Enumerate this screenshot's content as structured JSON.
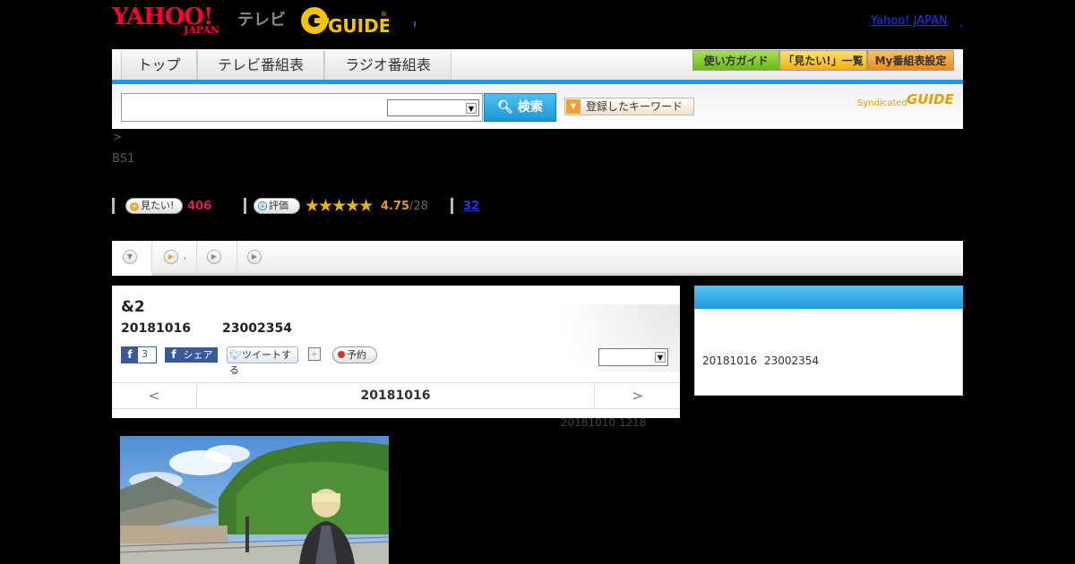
{
  "header": {
    "logo_yahoo": "YAHOO!",
    "logo_japan": "JAPAN",
    "logo_tv": "テレビ",
    "logo_gguide": "GUIDE",
    "yahoo_japan_link": "Yahoo! JAPAN",
    "link_dot": ","
  },
  "nav": {
    "tabs": [
      {
        "label": "トップ"
      },
      {
        "label": "テレビ番組表"
      },
      {
        "label": "ラジオ番組表"
      }
    ],
    "tools": [
      {
        "label": "使い方ガイド",
        "color": "#7ec820"
      },
      {
        "label": "「見たい!」一覧",
        "color": "#f5b800"
      },
      {
        "label": "My番組表設定",
        "color": "#f08c1e"
      }
    ]
  },
  "search": {
    "input_value": "",
    "select_value": "",
    "button_label": "検索",
    "keyword_button": "登録したキーワード",
    "syndicated": "Syndicated",
    "syndicated_g": "GUIDE"
  },
  "breadcrumb": ">",
  "channel": "BS1",
  "stats": {
    "want_label": "見たい!",
    "want_count": "406",
    "rate_label": "評価",
    "stars": "★★★★★",
    "rating": 4.75,
    "rating_text": "4.75",
    "rating_count": "/28",
    "comments": "32"
  },
  "subtabs": [
    {
      "icon": "chevron-down-icon",
      "label": ""
    },
    {
      "icon": "play-circle-icon",
      "label": ","
    },
    {
      "icon": "play-circle-icon",
      "label": ""
    },
    {
      "icon": "play-circle-icon",
      "label": ""
    }
  ],
  "program": {
    "title": "&2",
    "date": "20181016",
    "time": "23002354",
    "fb_count": "3",
    "share_label": "シェア",
    "tweet_label": "ツイートする",
    "reserve_label": "予約",
    "select_value": ""
  },
  "datenav": {
    "prev": "<",
    "date": "20181016",
    "next": ">"
  },
  "updated": "20181010  1218",
  "side": {
    "date": "20181016",
    "time": "23002354"
  },
  "colors": {
    "accent_blue": "#1d9be0",
    "yahoo_red": "#ff0033",
    "want_pink": "#e0195a",
    "rating_orange": "#e8961e",
    "star_gold": "#f2b400"
  }
}
